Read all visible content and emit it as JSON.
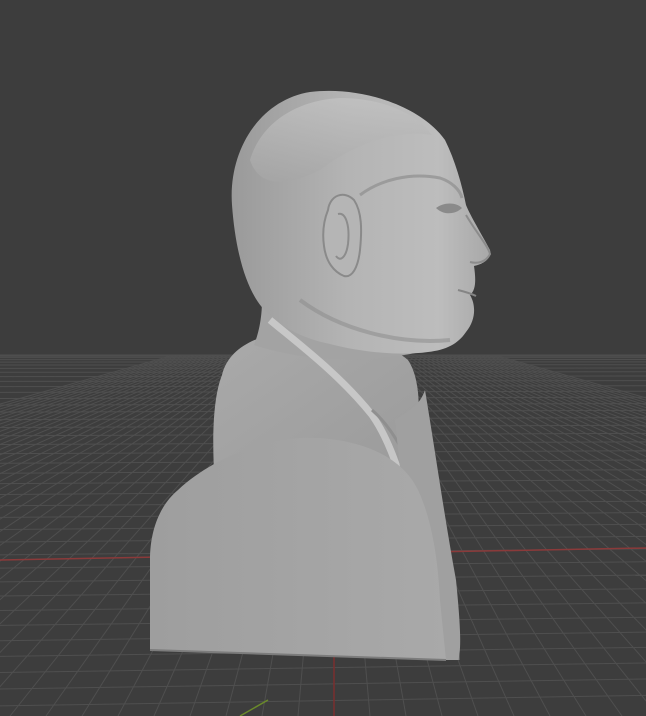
{
  "viewport": {
    "background_color": "#3d3d3d",
    "grid_color": "#4f4f4f",
    "x_axis_color": "#8b3a3a",
    "y_axis_color": "#6a8a2a",
    "model_color": "#a6a6a6",
    "model_shadow_color": "#7a7a7a",
    "model_highlight_color": "#c8c8c8"
  },
  "scene": {
    "object": "bust-model",
    "view": "side-profile"
  }
}
